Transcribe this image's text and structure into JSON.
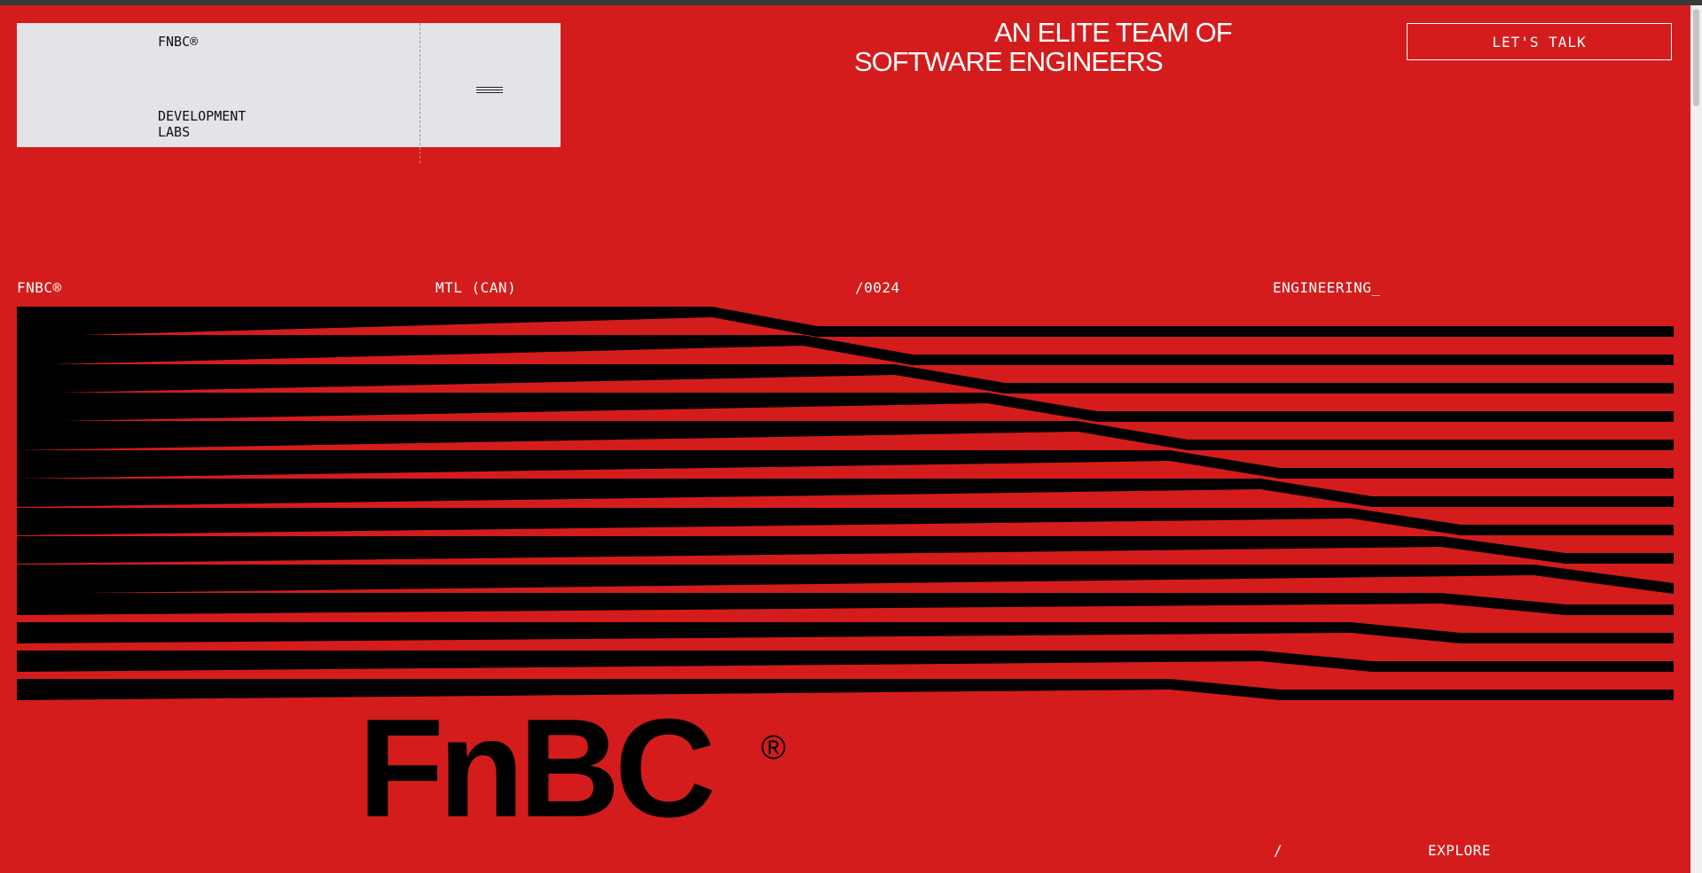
{
  "header": {
    "brand_top": "FNBC®",
    "brand_bottom": "DEVELOPMENT LABS",
    "menu_icon": "hamburger-icon",
    "headline_line1": "AN ELITE TEAM OF",
    "headline_line2": "SOFTWARE ENGINEERS",
    "cta_label": "LET'S TALK"
  },
  "meta_row": {
    "col1": "FNBC®",
    "col2": "MTL (CAN)",
    "col3": "/0024",
    "col4": "ENGINEERING_"
  },
  "wordmark": {
    "text": "FnBC",
    "registered": "®"
  },
  "footer": {
    "slash": "/",
    "explore_label": "EXPLORE"
  },
  "colors": {
    "background": "#d41c1c",
    "card": "#e3e4e8",
    "ink": "#000000",
    "text": "#ffffff"
  }
}
